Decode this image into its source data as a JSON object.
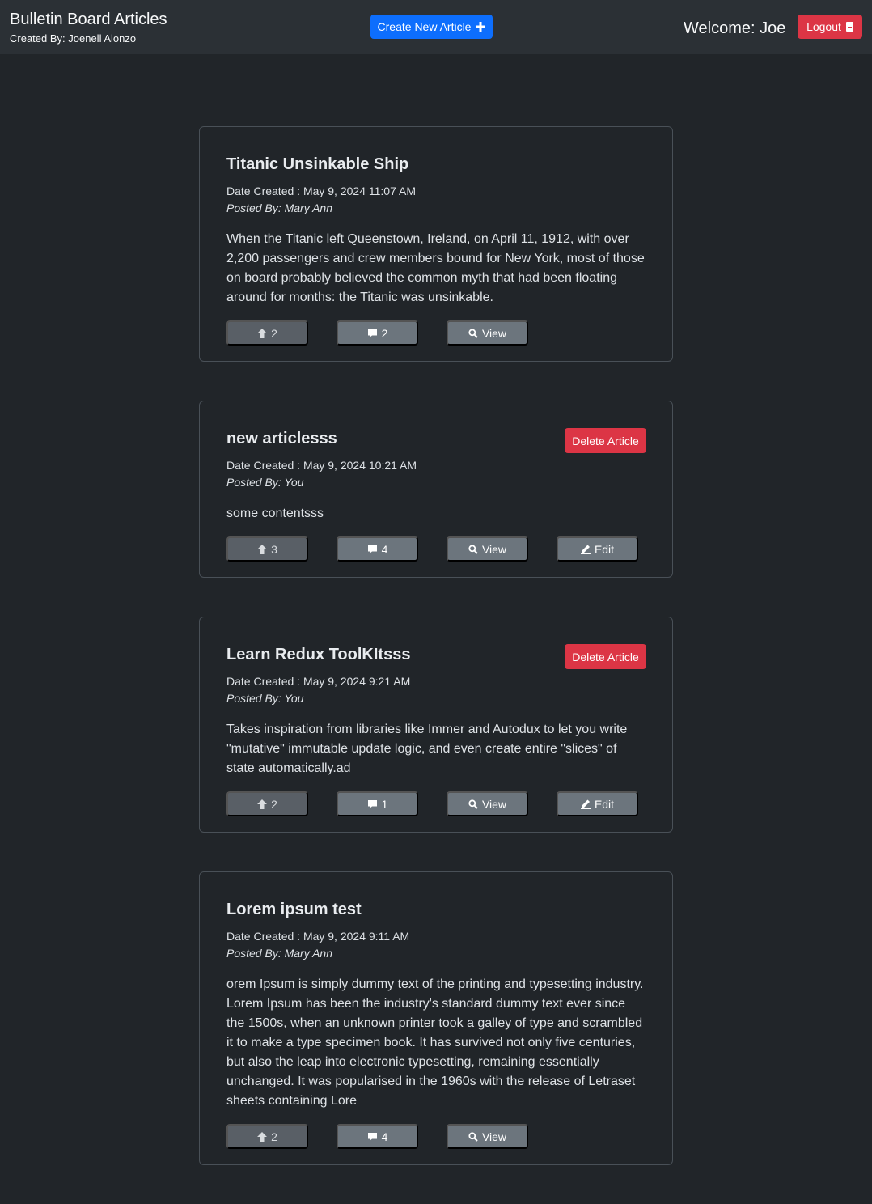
{
  "header": {
    "title": "Bulletin Board Articles",
    "subtitle": "Created By: Joenell Alonzo",
    "create_label": "Create New Article",
    "welcome": "Welcome: Joe",
    "logout_label": "Logout"
  },
  "articles": [
    {
      "title": "Titanic Unsinkable Ship",
      "date": "Date Created : May 9, 2024 11:07 AM",
      "author": "Posted By: Mary Ann",
      "body": "When the Titanic left Queenstown, Ireland, on April 11, 1912, with over 2,200 passengers and crew members bound for New York, most of those on board probably believed the common myth that had been floating around for months: the Titanic was unsinkable.",
      "upvotes": "2",
      "comments": "2",
      "view_label": "View"
    },
    {
      "title": "new articlesss",
      "date": "Date Created : May 9, 2024 10:21 AM",
      "author": "Posted By: You",
      "body": "some contentsss",
      "upvotes": "3",
      "comments": "4",
      "view_label": "View",
      "edit_label": "Edit",
      "delete_label": "Delete Article"
    },
    {
      "title": "Learn Redux ToolKItsss",
      "date": "Date Created : May 9, 2024 9:21 AM",
      "author": "Posted By: You",
      "body": "Takes inspiration from libraries like Immer and Autodux to let you write \"mutative\" immutable update logic, and even create entire \"slices\" of state automatically.ad",
      "upvotes": "2",
      "comments": "1",
      "view_label": "View",
      "edit_label": "Edit",
      "delete_label": "Delete Article"
    },
    {
      "title": "Lorem ipsum test",
      "date": "Date Created : May 9, 2024 9:11 AM",
      "author": "Posted By: Mary Ann",
      "body": "orem Ipsum is simply dummy text of the printing and typesetting industry. Lorem Ipsum has been the industry's standard dummy text ever since the 1500s, when an unknown printer took a galley of type and scrambled it to make a type specimen book. It has survived not only five centuries, but also the leap into electronic typesetting, remaining essentially unchanged. It was popularised in the 1960s with the release of Letraset sheets containing Lore",
      "upvotes": "2",
      "comments": "4",
      "view_label": "View"
    }
  ],
  "icons": {
    "create": "plus-icon",
    "logout": "door-icon",
    "upvote": "arrow-up-icon",
    "comment": "chat-icon",
    "view": "search-icon",
    "edit": "pencil-icon"
  },
  "colors": {
    "primary": "#0d6efd",
    "danger": "#dc3545",
    "secondary": "#6c757d",
    "background": "#212529"
  }
}
